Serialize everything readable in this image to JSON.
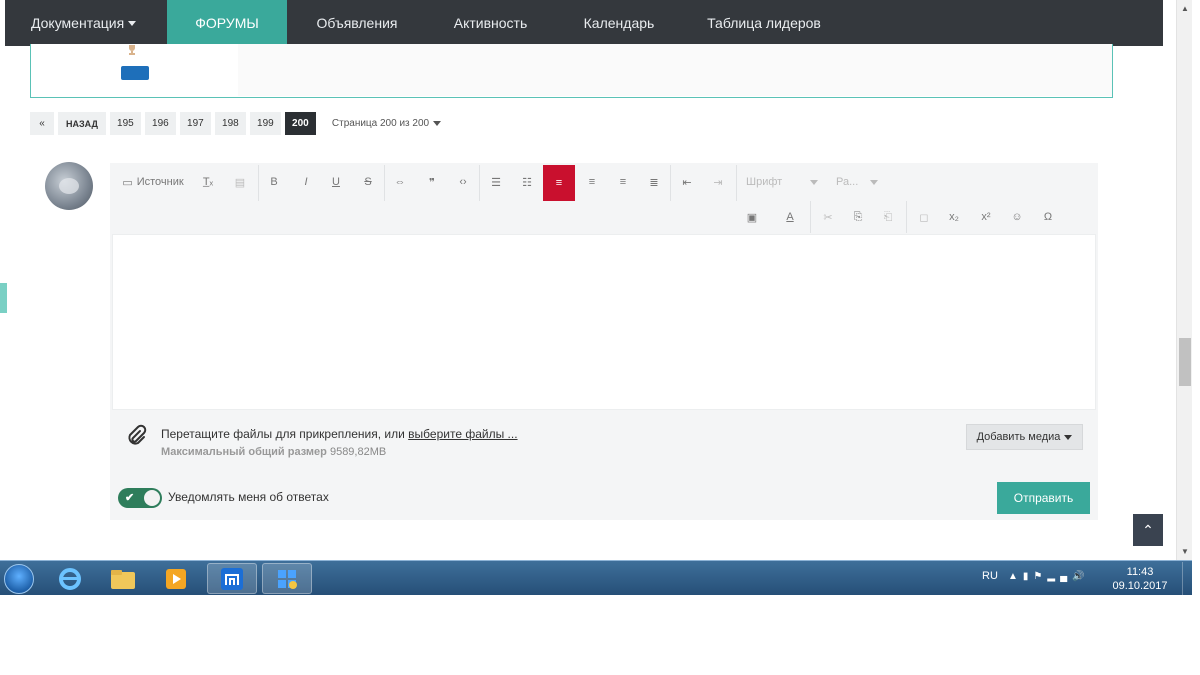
{
  "nav": {
    "items": [
      "Документация",
      "ФОРУМЫ",
      "Объявления",
      "Активность",
      "Календарь",
      "Таблица лидеров"
    ]
  },
  "pagination": {
    "back_label": "НАЗАД",
    "pages": [
      "195",
      "196",
      "197",
      "198",
      "199",
      "200"
    ],
    "current": "200",
    "info": "Страница 200 из 200"
  },
  "toolbar": {
    "source": "Источник",
    "font": "Шрифт",
    "size": "Ра..."
  },
  "attach": {
    "text": "Перетащите файлы для прикрепления, или",
    "link": "выберите файлы ...",
    "size_label": "Максимальный общий размер",
    "size_value": "9589,82MB",
    "add_media": "Добавить медиа"
  },
  "notify": {
    "label": "Уведомлять меня об ответах",
    "enabled": true
  },
  "send_label": "Отправить",
  "taskbar": {
    "lang": "RU",
    "time": "11:43",
    "date": "09.10.2017"
  }
}
